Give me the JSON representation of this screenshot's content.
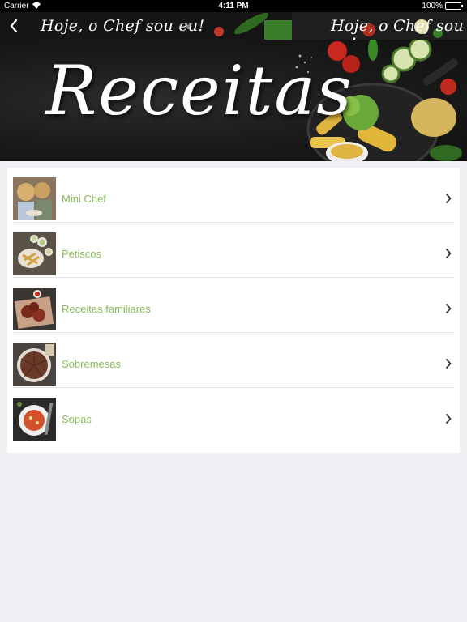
{
  "status_bar": {
    "carrier": "Carrier",
    "time": "4:11 PM",
    "battery": "100%"
  },
  "nav": {
    "back_icon": "chevron-left-icon",
    "banner_text_left": "Hoje, o Chef sou eu!",
    "banner_text_right": "Hoje, o Chef sou eu!"
  },
  "hero": {
    "title": "Receitas"
  },
  "list": {
    "items": [
      {
        "label": "Mini Chef",
        "thumb": "kids-cooking-photo"
      },
      {
        "label": "Petiscos",
        "thumb": "snacks-photo"
      },
      {
        "label": "Receitas familiares",
        "thumb": "family-recipes-photo"
      },
      {
        "label": "Sobremesas",
        "thumb": "desserts-photo"
      },
      {
        "label": "Sopas",
        "thumb": "soup-photo"
      }
    ]
  },
  "colors": {
    "accent": "#8bbb5b",
    "background": "#efeff4",
    "battery": "#4cd964"
  }
}
